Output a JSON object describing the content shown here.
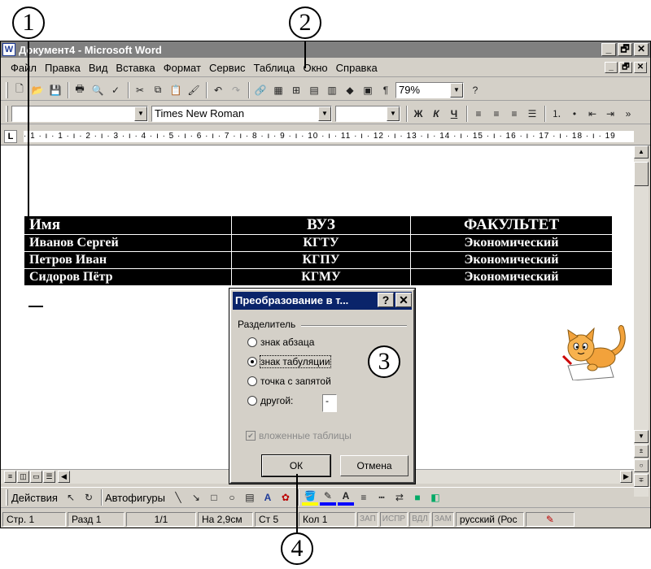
{
  "callouts": [
    "1",
    "2",
    "3",
    "4"
  ],
  "window": {
    "title": "Документ4 - Microsoft Word",
    "app_icon": "W",
    "controls": [
      "_",
      "🗗",
      "✕"
    ]
  },
  "menu": [
    "Файл",
    "Правка",
    "Вид",
    "Вставка",
    "Формат",
    "Сервис",
    "Таблица",
    "Окно",
    "Справка"
  ],
  "doc_controls": [
    "_",
    "🗗",
    "✕"
  ],
  "standard_toolbar": {
    "icons": [
      "new-document-icon",
      "open-icon",
      "save-icon",
      "print-icon",
      "print-preview-icon",
      "spelling-icon",
      "cut-icon",
      "copy-icon",
      "paste-icon",
      "format-painter-icon",
      "undo-icon",
      "redo-icon",
      "hyperlink-icon",
      "tables-borders-icon",
      "insert-table-icon",
      "insert-excel-icon",
      "columns-icon",
      "drawing-icon",
      "document-map-icon",
      "show-formatting-icon",
      "help-icon"
    ],
    "zoom": "79%"
  },
  "format_toolbar": {
    "style": "",
    "font": "Times New Roman",
    "size": "",
    "bold": "Ж",
    "italic": "К",
    "underline": "Ч"
  },
  "ruler": {
    "tab_selector": "L",
    "marks": "· 1 · ı · 1 · ı · 2 · ı · 3 · ı · 4 · ı · 5 · ı · 6 · ı · 7 · ı · 8 · ı · 9 · ı · 10 · ı · 11 · ı · 12 · ı · 13 · ı · 14 · ı · 15 · ı · 16 · ı · 17 · ı · 18 · ı · 19"
  },
  "table": {
    "headers": [
      "Имя",
      "ВУЗ",
      "ФАКУЛЬТЕТ"
    ],
    "rows": [
      [
        "Иванов Сергей",
        "КГТУ",
        "Экономический"
      ],
      [
        "Петров Иван",
        "КГПУ",
        "Экономический"
      ],
      [
        "Сидоров Пётр",
        "КГМУ",
        "Экономический"
      ]
    ]
  },
  "dialog": {
    "title": "Преобразование в т...",
    "help_button": "?",
    "close_button": "✕",
    "group_label": "Разделитель",
    "options": [
      {
        "label": "знак абзаца",
        "selected": false
      },
      {
        "label": "знак табуляции",
        "selected": true
      },
      {
        "label": "точка с запятой",
        "selected": false
      },
      {
        "label": "другой:",
        "selected": false
      }
    ],
    "other_value": "-",
    "nested_tables": "вложенные таблицы",
    "nested_checked": true,
    "ok": "ОК",
    "cancel": "Отмена"
  },
  "drawing_toolbar": {
    "actions": "Действия",
    "autoshapes": "Автофигуры"
  },
  "status": {
    "page": "Стр. 1",
    "section": "Разд 1",
    "pages": "1/1",
    "at": "На 2,9см",
    "line": "Ст 5",
    "col": "Кол 1",
    "rec": "ЗАП",
    "trk": "ИСПР",
    "ext": "ВДЛ",
    "ovr": "ЗАМ",
    "language": "русский (Рос"
  },
  "colors": {
    "title_active": "#0a246a",
    "title_inactive": "#808080",
    "face": "#d4d0c8"
  }
}
